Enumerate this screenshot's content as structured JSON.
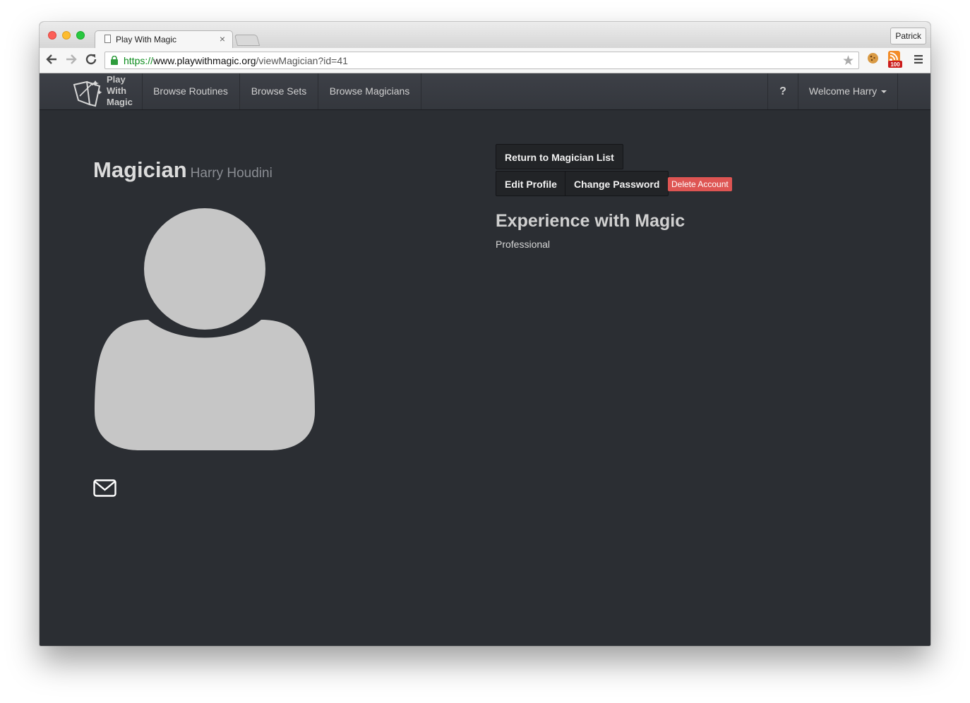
{
  "browser": {
    "tab_title": "Play With Magic",
    "tab_close": "×",
    "profile_name": "Patrick",
    "url_scheme": "https://",
    "url_host": "www.playwithmagic.org",
    "url_path": "/viewMagician?id=41",
    "back_icon": "arrow-left-icon",
    "forward_icon": "arrow-right-icon",
    "reload_icon": "reload-icon",
    "rss_badge": "100"
  },
  "navbar": {
    "brand": [
      "Play",
      "With",
      "Magic"
    ],
    "links": [
      "Browse Routines",
      "Browse Sets",
      "Browse Magicians"
    ],
    "help": "?",
    "user_menu": "Welcome Harry"
  },
  "profile": {
    "title": "Magician",
    "name": "Harry Houdini"
  },
  "actions": {
    "return": "Return to Magician List",
    "edit": "Edit Profile",
    "change_password": "Change Password",
    "delete": "Delete Account"
  },
  "experience": {
    "heading": "Experience with Magic",
    "value": "Professional"
  },
  "colors": {
    "background": "#2b2e33",
    "navbar": "#3a3d43",
    "danger": "#de5553",
    "avatar": "#c6c6c6"
  }
}
